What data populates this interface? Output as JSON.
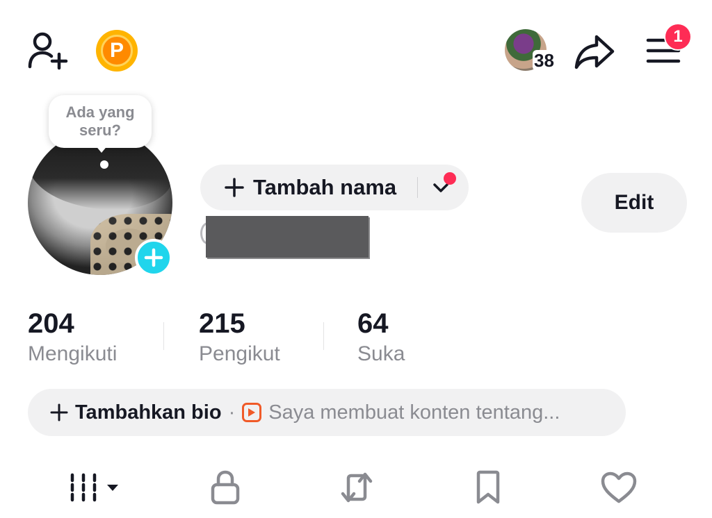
{
  "topbar": {
    "add_friend_icon": "person-plus-icon",
    "coin_icon": "coin-icon",
    "coin_letter": "P",
    "story_count": "38",
    "share_icon": "share-arrow-icon",
    "menu_icon": "hamburger-menu-icon",
    "menu_badge": "1"
  },
  "profile": {
    "bubble_text": "Ada yang seru?",
    "add_name_label": "Tambah nama",
    "edit_label": "Edit",
    "accent_color": "#20d5ec",
    "badge_color": "#fe2c55"
  },
  "stats": [
    {
      "value": "204",
      "label": "Mengikuti"
    },
    {
      "value": "215",
      "label": "Pengikut"
    },
    {
      "value": "64",
      "label": "Suka"
    }
  ],
  "bio": {
    "add_label": "Tambahkan bio",
    "separator": "·",
    "hint": "Saya membuat konten tentang..."
  },
  "tabs": [
    {
      "icon": "grid-videos-icon"
    },
    {
      "icon": "lock-icon"
    },
    {
      "icon": "repost-icon"
    },
    {
      "icon": "bookmark-icon"
    },
    {
      "icon": "heart-icon"
    }
  ]
}
